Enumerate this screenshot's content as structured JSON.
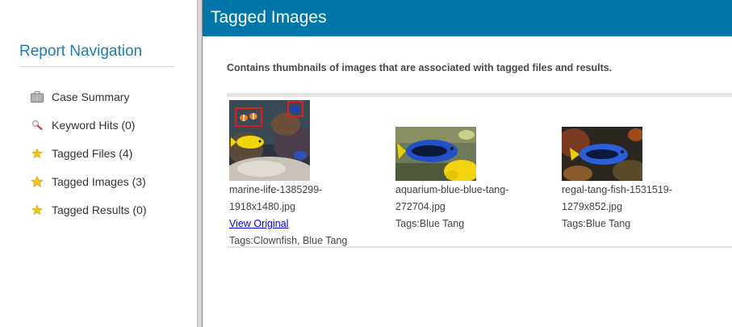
{
  "sidebar": {
    "title": "Report Navigation",
    "items": [
      {
        "label": "Case Summary",
        "icon": "briefcase-icon"
      },
      {
        "label": "Keyword Hits (0)",
        "icon": "magnifier-icon"
      },
      {
        "label": "Tagged Files (4)",
        "icon": "star-icon"
      },
      {
        "label": "Tagged Images (3)",
        "icon": "star-icon"
      },
      {
        "label": "Tagged Results (0)",
        "icon": "star-icon"
      }
    ]
  },
  "header": {
    "title": "Tagged Images"
  },
  "main": {
    "description": "Contains thumbnails of images that are associated with tagged files and results.",
    "images": [
      {
        "filename_line1": "marine-life-1385299-",
        "filename_line2": "1918x1480.jpg",
        "link": "View Original",
        "tags": "Tags:Clownfish, Blue Tang"
      },
      {
        "filename_line1": "aquarium-blue-blue-tang-",
        "filename_line2": "272704.jpg",
        "tags": "Tags:Blue Tang"
      },
      {
        "filename_line1": "regal-tang-fish-1531519-",
        "filename_line2": "1279x852.jpg",
        "tags": "Tags:Blue Tang"
      }
    ]
  },
  "colors": {
    "header_bg": "#0077a8",
    "nav_title": "#1d7bb1",
    "link": "#0000ee",
    "star": "#f5c518"
  }
}
